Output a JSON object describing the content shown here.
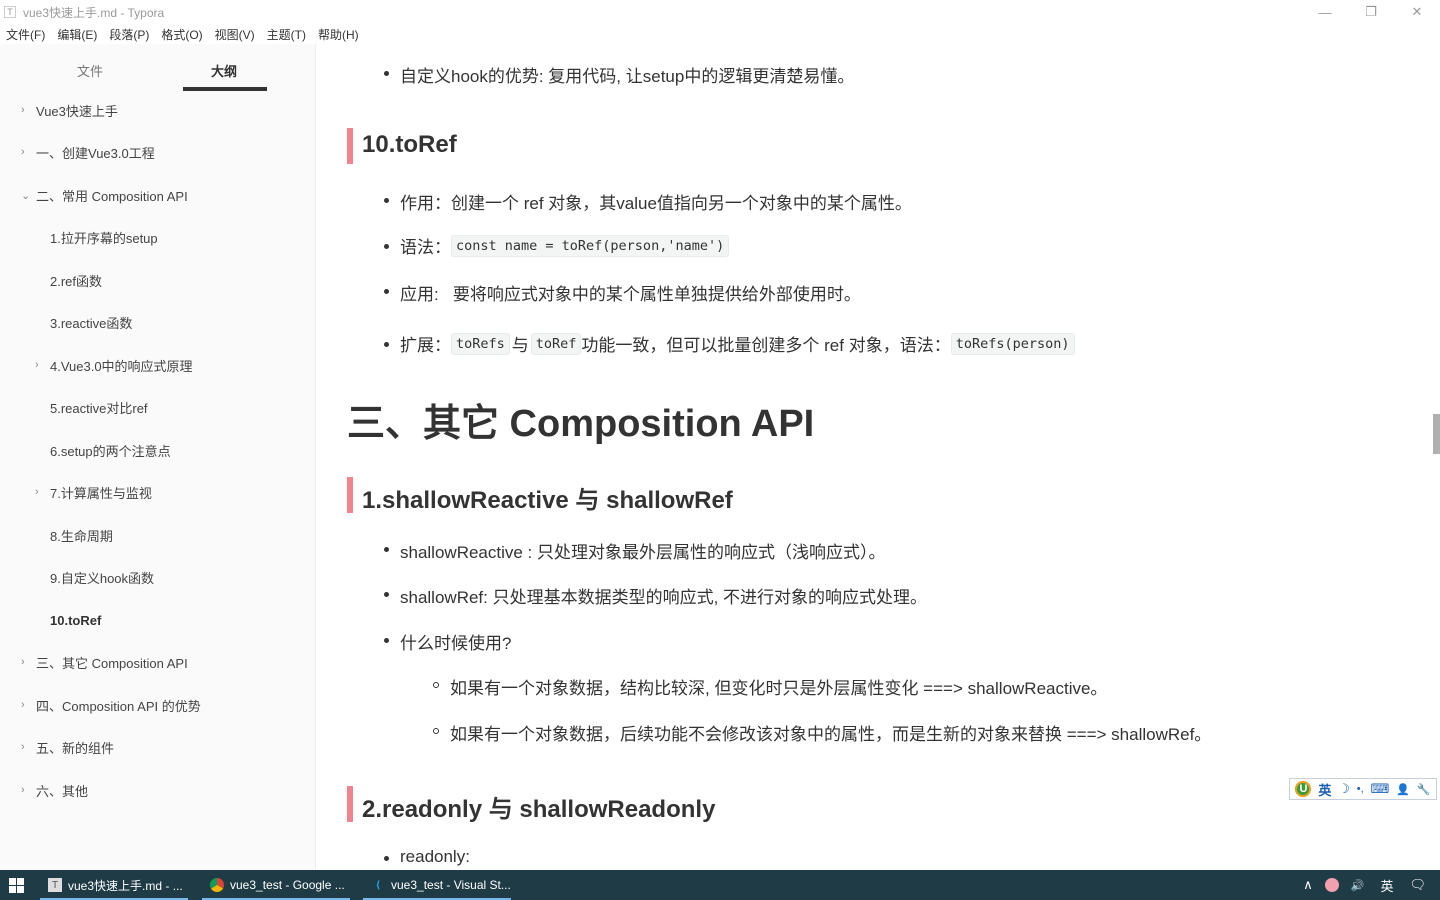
{
  "window": {
    "title": "vue3快速上手.md - Typora",
    "app_icon": "T",
    "controls": {
      "minimize": "—",
      "restore": "❐",
      "close": "✕"
    }
  },
  "menu": [
    "文件(F)",
    "编辑(E)",
    "段落(P)",
    "格式(O)",
    "视图(V)",
    "主题(T)",
    "帮助(H)"
  ],
  "sidebar": {
    "tabs": [
      {
        "label": "文件",
        "active": false
      },
      {
        "label": "大纲",
        "active": true
      }
    ],
    "outline": [
      {
        "label": "Vue3快速上手",
        "level": 1,
        "chevron": "›",
        "active": false
      },
      {
        "label": "一、创建Vue3.0工程",
        "level": 1,
        "chevron": "›",
        "active": false
      },
      {
        "label": "二、常用 Composition API",
        "level": 1,
        "chevron": "⌄",
        "active": false
      },
      {
        "label": "1.拉开序幕的setup",
        "level": 2,
        "chevron": "",
        "active": false
      },
      {
        "label": "2.ref函数",
        "level": 2,
        "chevron": "",
        "active": false
      },
      {
        "label": "3.reactive函数",
        "level": 2,
        "chevron": "",
        "active": false
      },
      {
        "label": "4.Vue3.0中的响应式原理",
        "level": 2,
        "chevron": "›",
        "active": false
      },
      {
        "label": "5.reactive对比ref",
        "level": 2,
        "chevron": "",
        "active": false
      },
      {
        "label": "6.setup的两个注意点",
        "level": 2,
        "chevron": "",
        "active": false
      },
      {
        "label": "7.计算属性与监视",
        "level": 2,
        "chevron": "›",
        "active": false
      },
      {
        "label": "8.生命周期",
        "level": 2,
        "chevron": "",
        "active": false
      },
      {
        "label": "9.自定义hook函数",
        "level": 2,
        "chevron": "",
        "active": false
      },
      {
        "label": "10.toRef",
        "level": 2,
        "chevron": "",
        "active": true
      },
      {
        "label": "三、其它 Composition API",
        "level": 1,
        "chevron": "›",
        "active": false
      },
      {
        "label": "四、Composition API 的优势",
        "level": 1,
        "chevron": "›",
        "active": false
      },
      {
        "label": "五、新的组件",
        "level": 1,
        "chevron": "›",
        "active": false
      },
      {
        "label": "六、其他",
        "level": 1,
        "chevron": "›",
        "active": false
      }
    ]
  },
  "document": {
    "hook_advantage": "自定义hook的优势: 复用代码, 让setup中的逻辑更清楚易懂。",
    "toref": {
      "heading": "10.toRef",
      "purpose": "作用：创建一个 ref 对象，其value值指向另一个对象中的某个属性。",
      "syntax_label": "语法：",
      "syntax_code": "const name = toRef(person,'name')",
      "usage": "应用:   要将响应式对象中的某个属性单独提供给外部使用时。",
      "ext_label": "扩展：",
      "ext_code1": "toRefs",
      "ext_and": "与",
      "ext_code2": "toRef",
      "ext_text": "功能一致，但可以批量创建多个 ref 对象，语法：",
      "ext_code3": "toRefs(person)"
    },
    "section3": {
      "heading": "三、其它 Composition API"
    },
    "shallow": {
      "heading": "1.shallowReactive 与 shallowRef",
      "item1": "shallowReactive : 只处理对象最外层属性的响应式（浅响应式）。",
      "item2": "shallowRef: 只处理基本数据类型的响应式, 不进行对象的响应式处理。",
      "item3": "什么时候使用?",
      "sub1": "如果有一个对象数据，结构比较深, 但变化时只是外层属性变化 ===> shallowReactive。",
      "sub2": "如果有一个对象数据，后续功能不会修改该对象中的属性，而是生新的对象来替换 ===> shallowRef。"
    },
    "readonly": {
      "heading": "2.readonly 与 shallowReadonly",
      "item1": "readonly:"
    }
  },
  "ime_toolbar": {
    "logo": "U",
    "lang": "英",
    "moon": "☽",
    "punct": "•,",
    "keyboard": "⌨",
    "user": "👤",
    "tools": "🔧"
  },
  "taskbar": {
    "tasks": [
      {
        "label": "vue3快速上手.md - ...",
        "icon": "typora-icon"
      },
      {
        "label": "vue3_test - Google ...",
        "icon": "chrome-icon"
      },
      {
        "label": "vue3_test - Visual St...",
        "icon": "vscode-icon"
      }
    ],
    "tray": {
      "chevron": "∧",
      "volume": "🔊",
      "lang": "英",
      "notify": "🗨"
    }
  }
}
